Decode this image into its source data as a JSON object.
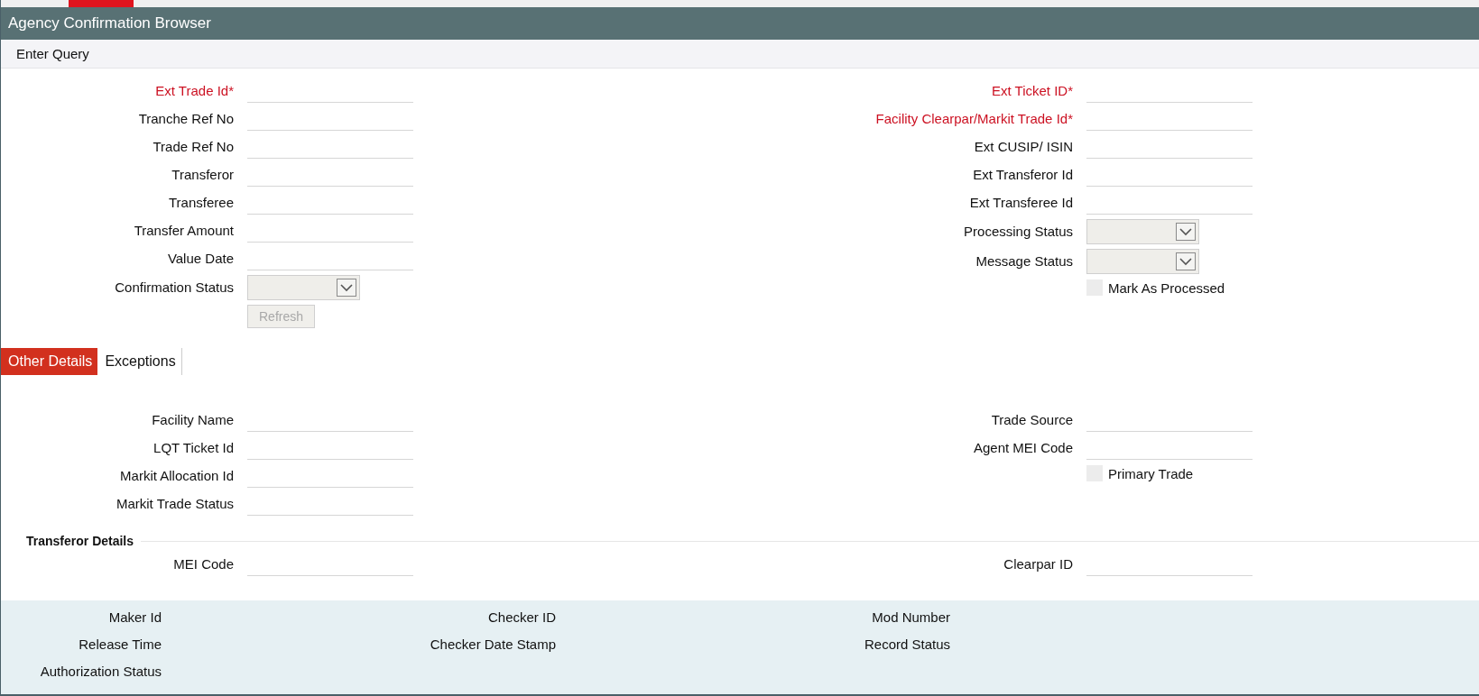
{
  "window": {
    "title": "Agency Confirmation Browser"
  },
  "query_bar": {
    "label": "Enter Query"
  },
  "query_form": {
    "left": [
      {
        "kind": "text",
        "label": "Ext Trade Id",
        "required": true,
        "required_mark": "*"
      },
      {
        "kind": "text",
        "label": "Tranche Ref No",
        "required": false
      },
      {
        "kind": "text",
        "label": "Trade Ref No",
        "required": false
      },
      {
        "kind": "text",
        "label": "Transferor",
        "required": false
      },
      {
        "kind": "text",
        "label": "Transferee",
        "required": false
      },
      {
        "kind": "text",
        "label": "Transfer Amount",
        "required": false
      },
      {
        "kind": "text",
        "label": "Value Date",
        "required": false
      },
      {
        "kind": "select",
        "label": "Confirmation Status",
        "required": false
      },
      {
        "kind": "button",
        "label": "Refresh",
        "disabled": true
      }
    ],
    "right": [
      {
        "kind": "text",
        "label": "Ext Ticket ID",
        "required": true,
        "required_mark": "*"
      },
      {
        "kind": "text",
        "label": "Facility Clearpar/Markit Trade Id",
        "required": true,
        "required_mark": "*"
      },
      {
        "kind": "text",
        "label": "Ext CUSIP/ ISIN",
        "required": false
      },
      {
        "kind": "text",
        "label": "Ext Transferor Id",
        "required": false
      },
      {
        "kind": "text",
        "label": "Ext Transferee Id",
        "required": false
      },
      {
        "kind": "select",
        "label": "Processing Status",
        "required": false
      },
      {
        "kind": "select",
        "label": "Message Status",
        "required": false
      },
      {
        "kind": "checkbox",
        "label": "Mark As Processed",
        "checked": false
      }
    ]
  },
  "tabs": [
    {
      "label": "Other Details",
      "selected": true
    },
    {
      "label": "Exceptions",
      "selected": false
    }
  ],
  "details": {
    "left": [
      {
        "kind": "text",
        "label": "Facility Name",
        "required": false
      },
      {
        "kind": "text",
        "label": "LQT Ticket Id",
        "required": false
      },
      {
        "kind": "text",
        "label": "Markit Allocation Id",
        "required": false
      },
      {
        "kind": "text",
        "label": "Markit Trade Status",
        "required": false
      }
    ],
    "right": [
      {
        "kind": "text",
        "label": "Trade Source",
        "required": false
      },
      {
        "kind": "text",
        "label": "Agent MEI Code",
        "required": false
      },
      {
        "kind": "checkbox",
        "label": "Primary Trade",
        "checked": false
      }
    ]
  },
  "transferor_details": {
    "title": "Transferor Details",
    "left": [
      {
        "kind": "text",
        "label": "MEI Code",
        "required": false
      }
    ],
    "right": [
      {
        "kind": "text",
        "label": "Clearpar ID",
        "required": false
      }
    ]
  },
  "audit": {
    "columns": [
      [
        "Maker Id",
        "Release Time",
        "Authorization Status"
      ],
      [
        "Checker ID",
        "Checker Date Stamp"
      ],
      [
        "Mod Number",
        "Record Status"
      ]
    ]
  }
}
